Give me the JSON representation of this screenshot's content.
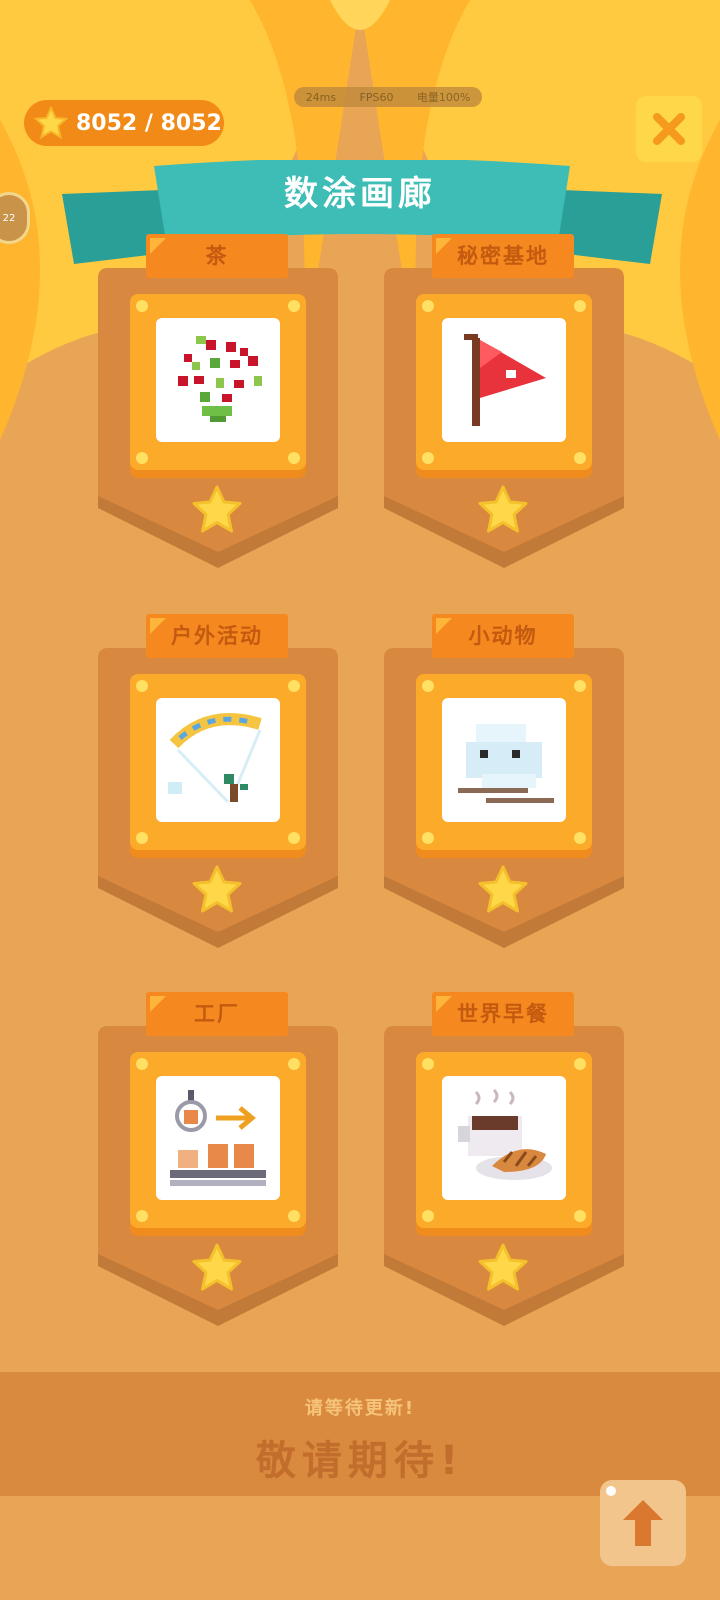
{
  "colors": {
    "accent": "#f5891f",
    "ribbon": "#37b7b0",
    "gold": "#ffcf3a",
    "background": "#e9a556"
  },
  "header": {
    "coins": "8052 / 8052",
    "status": {
      "ping": "24ms",
      "fps": "FPS60",
      "power": "电量100%"
    },
    "side_badge": "22",
    "title": "数涂画廊",
    "close_icon": "close-icon"
  },
  "categories": [
    {
      "label": "茶",
      "art": "tea-berries-art",
      "stars": 1
    },
    {
      "label": "秘密基地",
      "art": "flag-art",
      "stars": 1
    },
    {
      "label": "户外活动",
      "art": "paraglider-art",
      "stars": 1
    },
    {
      "label": "小动物",
      "art": "bird-art",
      "stars": 1
    },
    {
      "label": "工厂",
      "art": "factory-art",
      "stars": 1
    },
    {
      "label": "世界早餐",
      "art": "breakfast-art",
      "stars": 1
    }
  ],
  "footer": {
    "subtitle": "请等待更新!",
    "title": "敬请期待!"
  },
  "scroll_up_icon": "arrow-up-icon"
}
